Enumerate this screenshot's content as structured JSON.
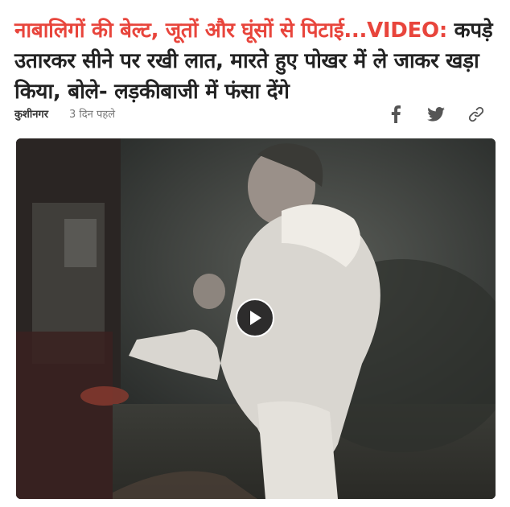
{
  "headline": {
    "highlight": "नाबालिगों की बेल्ट, जूतों और घूंसों से पिटाई...VIDEO:",
    "rest": " कपड़े उतारकर सीने पर रखी लात, मारते हुए पोखर में ले जाकर खड़ा किया, बोले- लड़कीबाजी में फंसा देंगे"
  },
  "meta": {
    "location": "कुशीनगर",
    "time_ago": "3 दिन पहले"
  },
  "share": {
    "facebook_icon": "facebook-icon",
    "twitter_icon": "twitter-icon",
    "link_icon": "link-icon"
  },
  "video": {
    "play_icon": "play-icon"
  },
  "colors": {
    "headline_highlight": "#e8453c",
    "headline_text": "#222222",
    "meta_text": "#777777",
    "icon": "#555555"
  }
}
